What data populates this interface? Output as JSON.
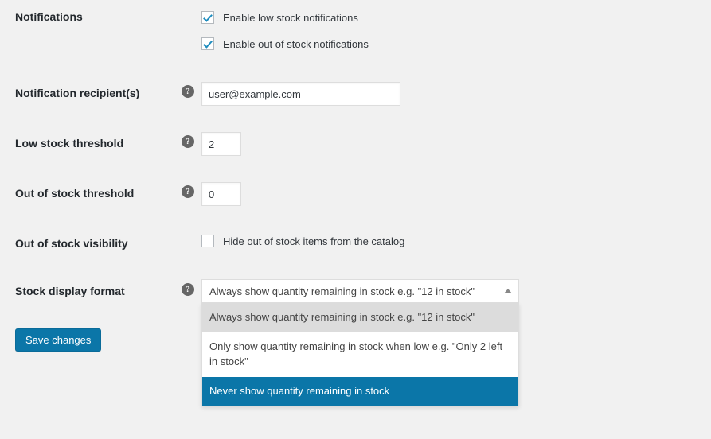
{
  "rows": {
    "notifications": {
      "label": "Notifications",
      "options": [
        {
          "label": "Enable low stock notifications",
          "checked": true
        },
        {
          "label": "Enable out of stock notifications",
          "checked": true
        }
      ]
    },
    "recipients": {
      "label": "Notification recipient(s)",
      "help": "?",
      "value": "user@example.com",
      "placeholder": ""
    },
    "low_stock_threshold": {
      "label": "Low stock threshold",
      "help": "?",
      "value": "2",
      "placeholder": ""
    },
    "out_of_stock_threshold": {
      "label": "Out of stock threshold",
      "help": "?",
      "value": "0",
      "placeholder": ""
    },
    "out_of_stock_visibility": {
      "label": "Out of stock visibility",
      "checkbox_label": "Hide out of stock items from the catalog",
      "checked": false
    },
    "stock_display_format": {
      "label": "Stock display format",
      "help": "?",
      "selected_value": "Always show quantity remaining in stock e.g. \"12 in stock\"",
      "expanded": true,
      "arrow_icon": "chevron-up-icon",
      "options": [
        {
          "label": "Always show quantity remaining in stock e.g. \"12 in stock\"",
          "state": "hovered"
        },
        {
          "label": "Only show quantity remaining in stock when low e.g. \"Only 2 left in stock\"",
          "state": "normal"
        },
        {
          "label": "Never show quantity remaining in stock",
          "state": "selected"
        }
      ]
    }
  },
  "actions": {
    "save_label": "Save changes"
  },
  "colors": {
    "page_background": "#f1f1f1",
    "accent_blue": "#0b76a8",
    "checkbox_check": "#1e8cbe",
    "label_text": "#23282d",
    "body_text": "#32373c",
    "option_hover_background": "#dcdcdc",
    "input_border": "#dddddd"
  }
}
